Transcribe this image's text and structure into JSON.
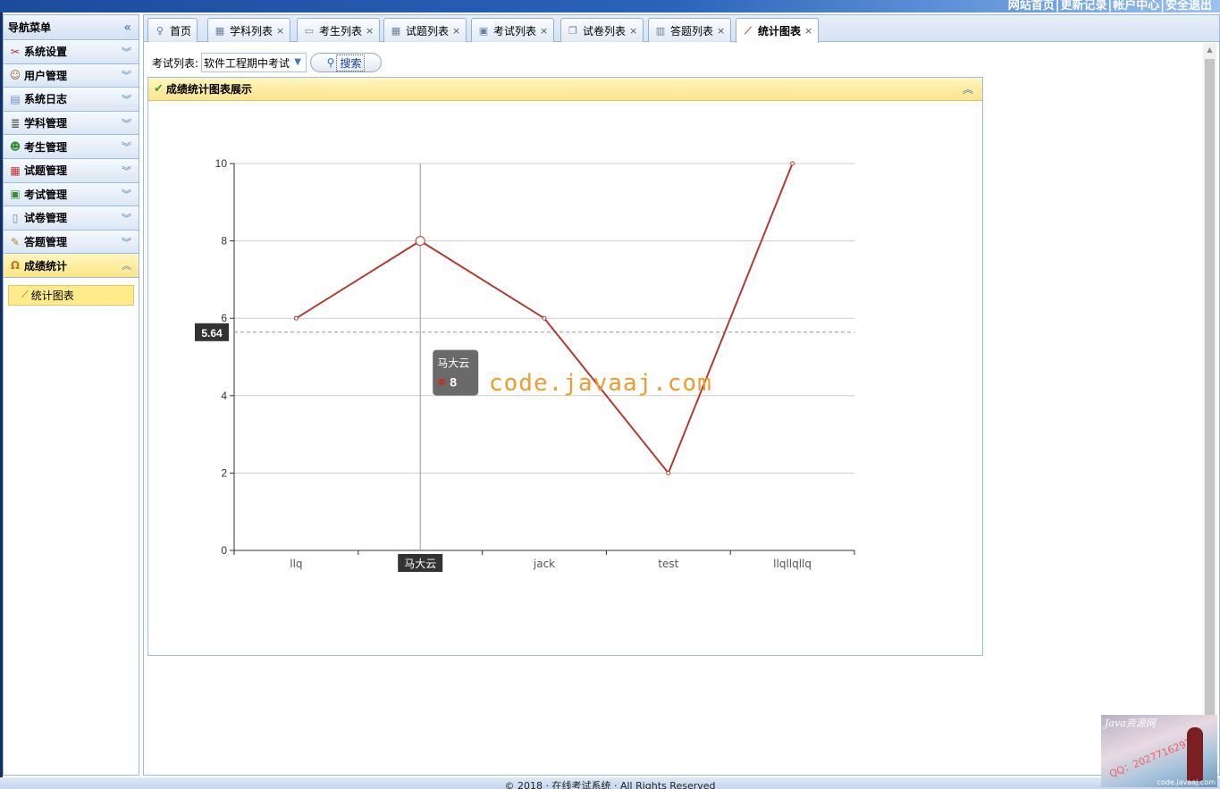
{
  "top_links": [
    "网站首页",
    "更新记录",
    "帐户中心",
    "安全退出"
  ],
  "nav": {
    "title": "导航菜单",
    "collapse_glyph": "«",
    "items": [
      {
        "label": "系统设置",
        "icon": "tools-icon",
        "glyph": "✂",
        "color": "#b03030"
      },
      {
        "label": "用户管理",
        "icon": "users-icon",
        "glyph": "☺",
        "color": "#9b6a2a"
      },
      {
        "label": "系统日志",
        "icon": "log-icon",
        "glyph": "▤",
        "color": "#6b8fc2"
      },
      {
        "label": "学科管理",
        "icon": "list-icon",
        "glyph": "≣",
        "color": "#555555"
      },
      {
        "label": "考生管理",
        "icon": "students-icon",
        "glyph": "☻",
        "color": "#3b8f3b"
      },
      {
        "label": "试题管理",
        "icon": "calendar-icon",
        "glyph": "▦",
        "color": "#c03030"
      },
      {
        "label": "考试管理",
        "icon": "exam-icon",
        "glyph": "▣",
        "color": "#3a8a3a"
      },
      {
        "label": "试卷管理",
        "icon": "paper-icon",
        "glyph": "▯",
        "color": "#7a8aa0"
      },
      {
        "label": "答题管理",
        "icon": "pen-icon",
        "glyph": "✎",
        "color": "#b08a2a"
      },
      {
        "label": "成绩统计",
        "icon": "stats-icon",
        "glyph": "Ω",
        "color": "#c07a1a",
        "active": true
      }
    ],
    "sub_items": [
      {
        "label": "统计图表",
        "icon": "line-chart-icon",
        "glyph": "⟋"
      }
    ]
  },
  "tabs": [
    {
      "label": "首页",
      "icon": "lightbulb-icon",
      "glyph": "♀",
      "closable": false
    },
    {
      "label": "学科列表",
      "icon": "table-icon",
      "glyph": "▦",
      "closable": true
    },
    {
      "label": "考生列表",
      "icon": "card-icon",
      "glyph": "▭",
      "closable": true
    },
    {
      "label": "试题列表",
      "icon": "calendar-icon",
      "glyph": "▦",
      "closable": true
    },
    {
      "label": "考试列表",
      "icon": "exam-icon",
      "glyph": "▣",
      "closable": true
    },
    {
      "label": "试卷列表",
      "icon": "copy-icon",
      "glyph": "❐",
      "closable": true
    },
    {
      "label": "答题列表",
      "icon": "report-icon",
      "glyph": "▥",
      "closable": true
    },
    {
      "label": "统计图表",
      "icon": "line-chart-icon",
      "glyph": "⟋",
      "closable": true,
      "active": true
    }
  ],
  "filter": {
    "label": "考试列表:",
    "selected_exam": "软件工程期中考试",
    "search_label": "搜索"
  },
  "panel": {
    "title": "成绩统计图表展示"
  },
  "chart_data": {
    "type": "line",
    "categories": [
      "llq",
      "马大云",
      "jack",
      "test",
      "llqllqllq"
    ],
    "series": [
      {
        "values": [
          6,
          8,
          6,
          2,
          10
        ],
        "color": "#b53a2f"
      }
    ],
    "ylim": [
      0,
      10
    ],
    "yticks": [
      0,
      2,
      4,
      6,
      8,
      10
    ],
    "mark_line": {
      "label": "5.64",
      "value": 5.64
    },
    "tooltip": {
      "category": "马大云",
      "value": "8"
    },
    "grid": true
  },
  "watermark": "code.javaaj.com",
  "footer_text": "© 2018 · 在线考试系统 · All Rights Reserved",
  "corner_image": {
    "title": "Java资源网",
    "qq": "QQ：2027716292",
    "url": "code.javaaj.com"
  }
}
